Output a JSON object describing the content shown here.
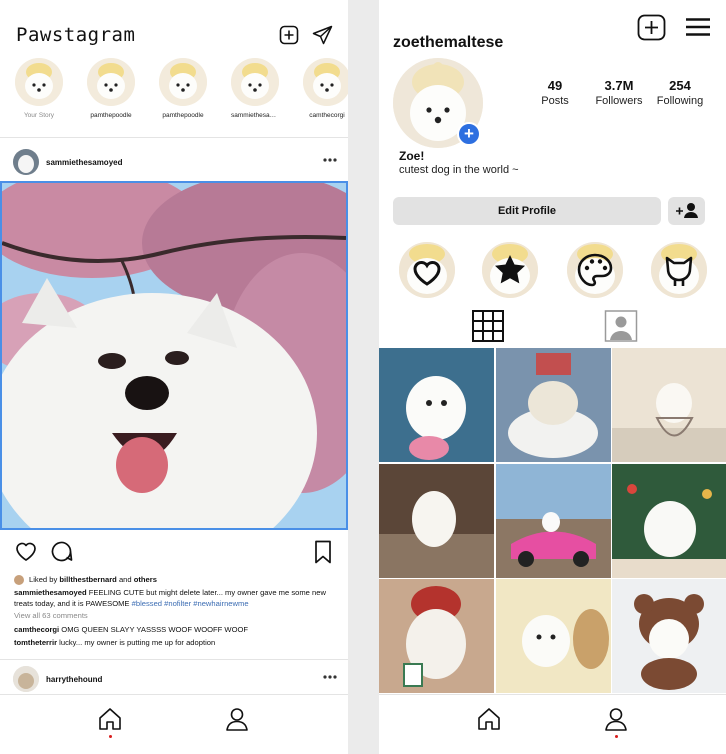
{
  "feed": {
    "app_title": "Pawstagram",
    "stories": [
      {
        "label": "Your Story",
        "muted": true
      },
      {
        "label": "pamthepoodle",
        "muted": false
      },
      {
        "label": "pamthepoodle",
        "muted": false
      },
      {
        "label": "sammiethesamoyed",
        "muted": false
      },
      {
        "label": "camthecorgi",
        "muted": false
      }
    ],
    "post": {
      "username": "sammiethesamoyed",
      "liked_prefix": "Liked by",
      "liked_user": "billthestbernard",
      "liked_and": "and",
      "liked_others": "others",
      "caption_user": "sammiethesamoyed",
      "caption_text": "FEELING CUTE but might delete later... my owner gave me some new treats today, and it is PAWESOME",
      "caption_tags": "#blessed #nofilter #newhairnewme",
      "view_all": "View all 63 comments",
      "comments": [
        {
          "user": "camthecorgi",
          "text": "OMG QUEEN SLAYY YASSSS WOOF WOOFF WOOF"
        },
        {
          "user": "tomtheterrir",
          "text": "lucky... my owner is putting me up for adoption"
        }
      ]
    },
    "next_post": {
      "username": "harrythehound"
    }
  },
  "profile": {
    "username": "zoethemaltese",
    "stats": {
      "posts": {
        "value": "49",
        "label": "Posts"
      },
      "followers": {
        "value": "3.7M",
        "label": "Followers"
      },
      "following": {
        "value": "254",
        "label": "Following"
      }
    },
    "display_name": "Zoe!",
    "bio": "cutest dog in the world ~",
    "edit_profile": "Edit Profile",
    "highlights": [
      "heart-icon",
      "star-icon",
      "palette-icon",
      "cat-icon"
    ]
  },
  "colors": {
    "accent_blue": "#2d6fe0",
    "selection_border": "#4a8fe7",
    "nav_dot": "#d81e1e",
    "hashtag": "#3c6db3"
  }
}
